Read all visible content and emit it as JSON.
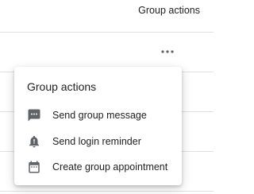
{
  "table": {
    "header": {
      "group_actions_label": "Group actions"
    }
  },
  "menu": {
    "title": "Group actions",
    "items": [
      {
        "label": "Send group message",
        "icon": "message-icon"
      },
      {
        "label": "Send login reminder",
        "icon": "bell-alert-icon"
      },
      {
        "label": "Create group appointment",
        "icon": "calendar-icon"
      }
    ]
  },
  "colors": {
    "text": "#202124",
    "icon": "#5f6368",
    "divider": "#e0e0e0"
  }
}
